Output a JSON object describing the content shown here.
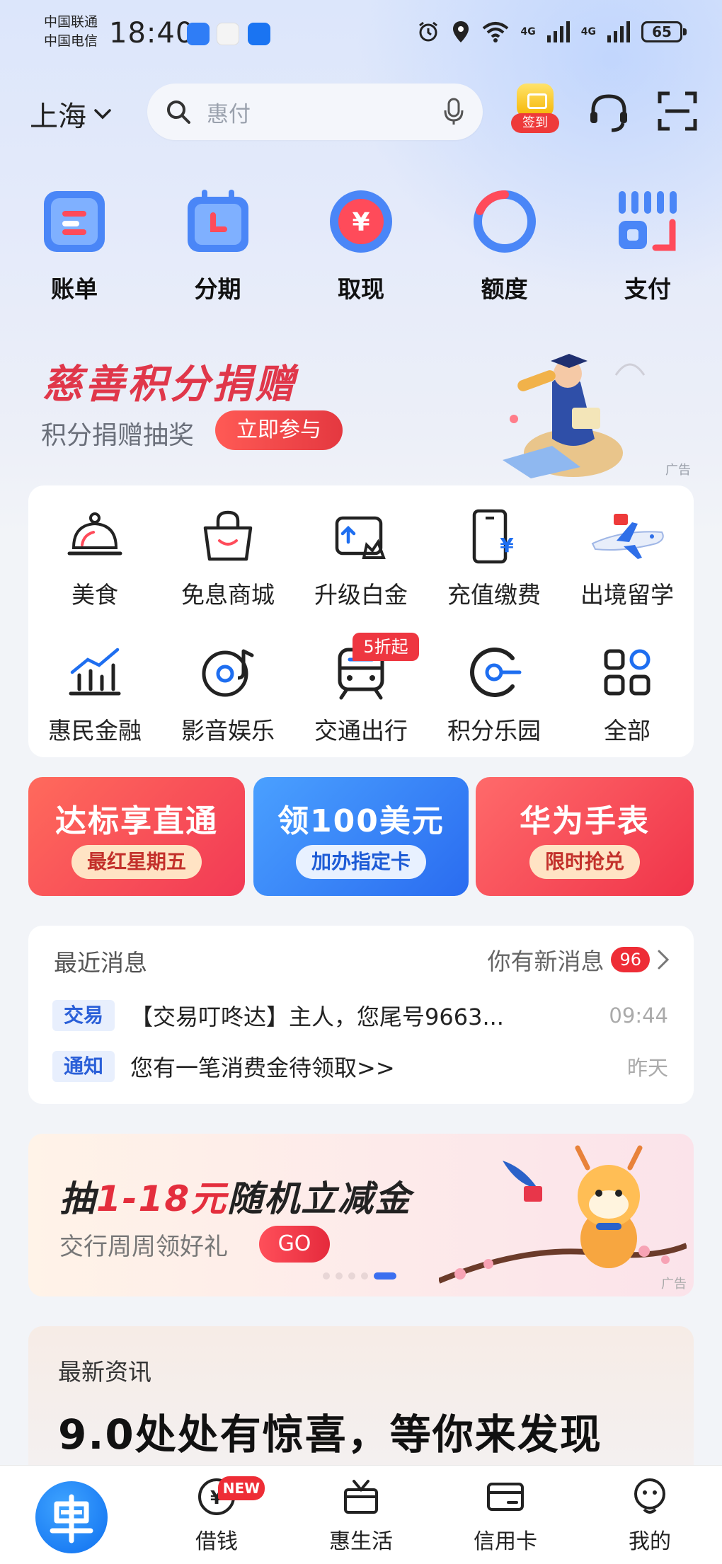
{
  "status_bar": {
    "carrier_1": "中国联通",
    "carrier_2": "中国电信",
    "time": "18:40",
    "network_1": "4G",
    "network_2": "4G",
    "battery": "65"
  },
  "header": {
    "city": "上海",
    "search_placeholder": "惠付",
    "signin_label": "签到"
  },
  "quick_actions": [
    {
      "label": "账单",
      "icon": "bill-icon"
    },
    {
      "label": "分期",
      "icon": "calendar-icon"
    },
    {
      "label": "取现",
      "icon": "yuan-coin-icon"
    },
    {
      "label": "额度",
      "icon": "quota-ring-icon"
    },
    {
      "label": "支付",
      "icon": "pay-code-icon"
    }
  ],
  "charity_banner": {
    "title": "慈善积分捐赠",
    "subtitle": "积分捐赠抽奖",
    "button": "立即参与",
    "ad": "广告"
  },
  "services": [
    {
      "label": "美食",
      "icon": "dining-bell-icon"
    },
    {
      "label": "免息商城",
      "icon": "shopping-bag-icon"
    },
    {
      "label": "升级白金",
      "icon": "upgrade-card-icon"
    },
    {
      "label": "充值缴费",
      "icon": "phone-topup-icon"
    },
    {
      "label": "出境留学",
      "icon": "airplane-icon"
    },
    {
      "label": "惠民金融",
      "icon": "chart-icon"
    },
    {
      "label": "影音娱乐",
      "icon": "music-disc-icon"
    },
    {
      "label": "交通出行",
      "icon": "train-icon"
    },
    {
      "label": "积分乐园",
      "icon": "points-c-icon"
    },
    {
      "label": "全部",
      "icon": "grid-icon"
    }
  ],
  "transport_badge": "5折起",
  "promos": [
    {
      "title": "达标享直通",
      "button": "最红星期五"
    },
    {
      "title": "领100美元",
      "button": "加办指定卡"
    },
    {
      "title": "华为手表",
      "button": "限时抢兑"
    }
  ],
  "messages": {
    "header": "最近消息",
    "new_label": "你有新消息",
    "count": "96",
    "items": [
      {
        "tag": "交易",
        "text": "【交易叮咚达】主人，您尾号9663...",
        "time": "09:44"
      },
      {
        "tag": "通知",
        "text": "您有一笔消费金待领取>>",
        "time": "昨天"
      }
    ]
  },
  "lottery_banner": {
    "title_prefix": "抽",
    "title_highlight": "1-18元",
    "title_suffix": "随机立减金",
    "subtitle": "交行周周领好礼",
    "button": "GO",
    "ad": "广告",
    "slide_count": 5,
    "active_slide": 5
  },
  "news": {
    "header": "最新资讯",
    "title": "9.0处处有惊喜，等你来发现"
  },
  "bottom_nav": {
    "items": [
      {
        "label": "借钱",
        "icon": "loan-yuan-icon"
      },
      {
        "label": "惠生活",
        "icon": "gift-tv-icon"
      },
      {
        "label": "信用卡",
        "icon": "credit-card-icon"
      },
      {
        "label": "我的",
        "icon": "profile-icon"
      }
    ],
    "new_badge": "NEW"
  },
  "colors": {
    "accent_red": "#e42e3d",
    "accent_blue": "#2a6cf0"
  }
}
